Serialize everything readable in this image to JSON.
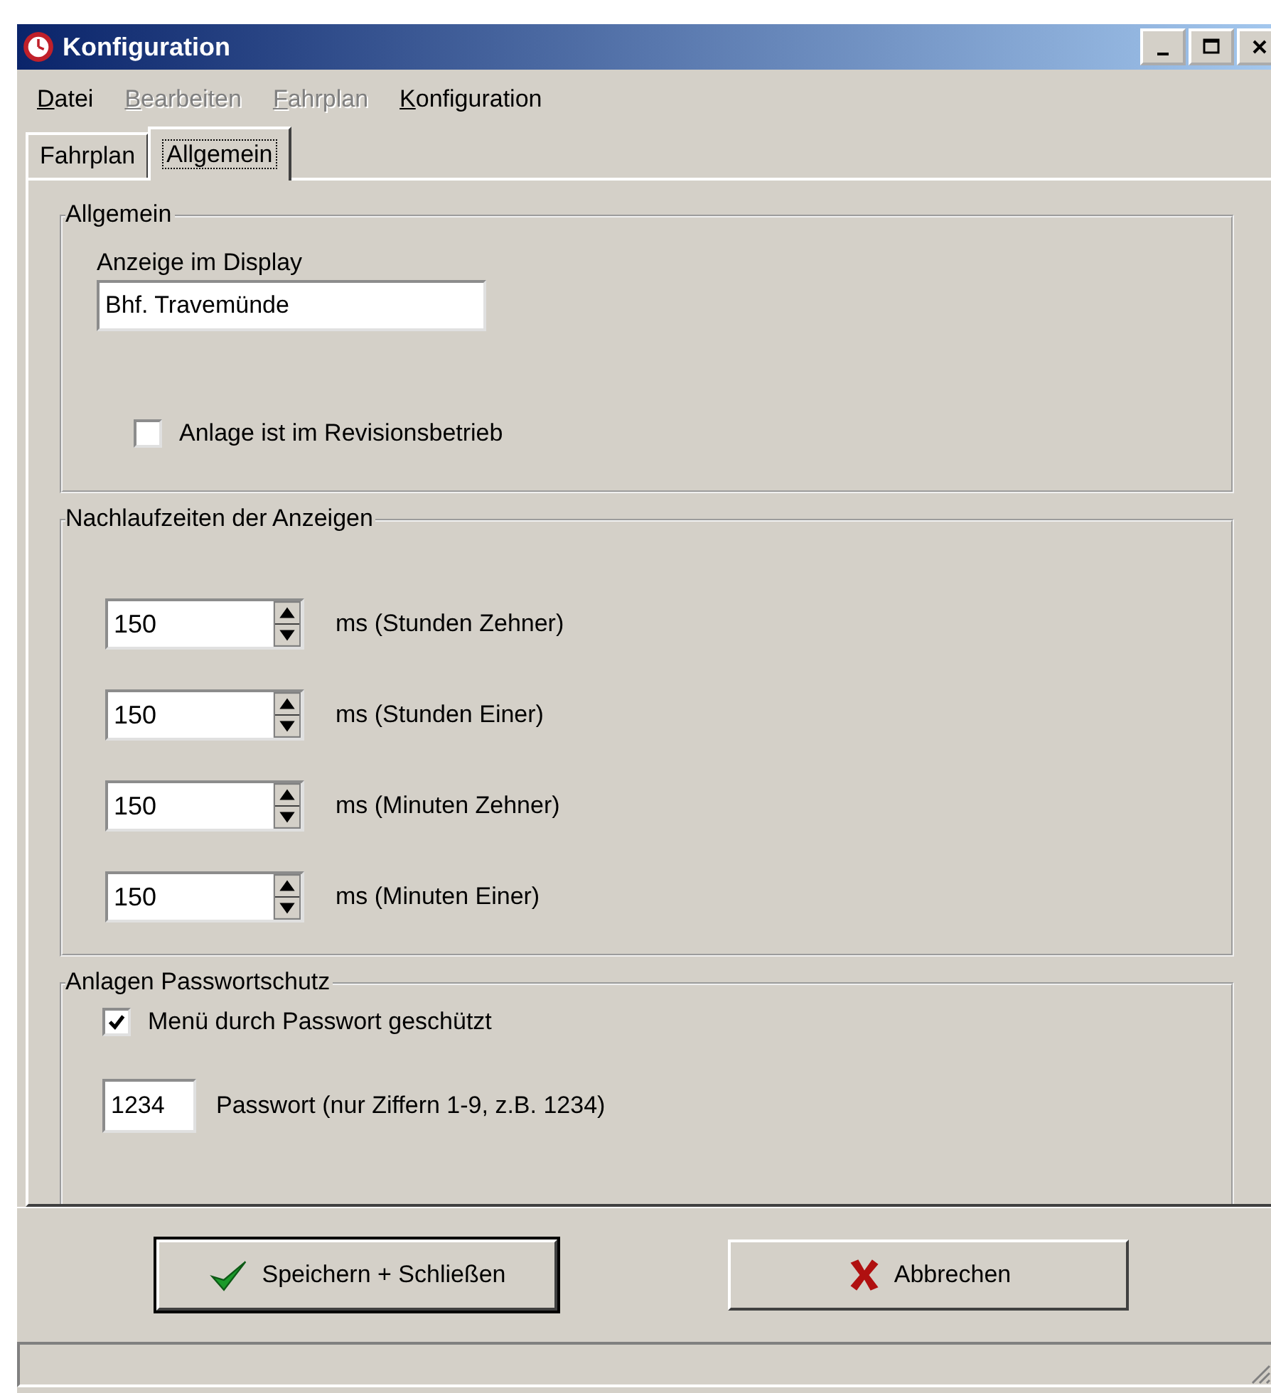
{
  "window": {
    "title": "Konfiguration"
  },
  "menu": [
    {
      "label": "Datei",
      "disabled": false
    },
    {
      "label": "Bearbeiten",
      "disabled": true
    },
    {
      "label": "Fahrplan",
      "disabled": true
    },
    {
      "label": "Konfiguration",
      "disabled": false
    }
  ],
  "tabs": [
    {
      "label": "Fahrplan",
      "selected": false
    },
    {
      "label": "Allgemein",
      "selected": true
    }
  ],
  "groups": [
    {
      "title": "Allgemein",
      "items": [
        {
          "kind": "text",
          "label": "Anzeige im Display",
          "value": "Bhf. Travemünde"
        },
        {
          "kind": "checkbox",
          "label": "Anlage ist im Revisionsbetrieb",
          "checked": false
        }
      ]
    },
    {
      "title": "Nachlaufzeiten der Anzeigen",
      "items": [
        {
          "kind": "spinner",
          "value": "150",
          "label": "ms (Stunden Zehner)"
        },
        {
          "kind": "spinner",
          "value": "150",
          "label": "ms (Stunden Einer)"
        },
        {
          "kind": "spinner",
          "value": "150",
          "label": "ms (Minuten Zehner)"
        },
        {
          "kind": "spinner",
          "value": "150",
          "label": "ms (Minuten Einer)"
        }
      ]
    },
    {
      "title": "Anlagen Passwortschutz",
      "items": [
        {
          "kind": "checkbox",
          "label": "Menü durch Passwort geschützt",
          "checked": true
        },
        {
          "kind": "password",
          "value": "1234",
          "label": "Passwort (nur Ziffern 1-9, z.B. 1234)"
        }
      ]
    }
  ],
  "buttons": [
    {
      "label": "Speichern + Schließen",
      "kind": "save",
      "default": true
    },
    {
      "label": "Abbrechen",
      "kind": "cancel",
      "default": false
    }
  ]
}
